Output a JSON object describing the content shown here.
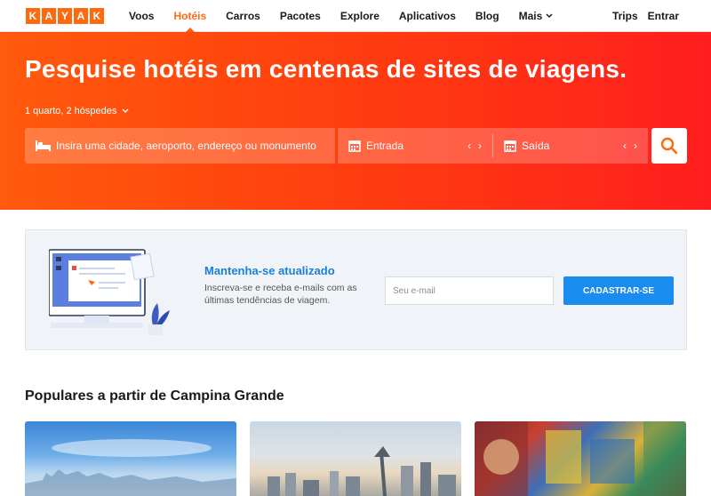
{
  "brand": {
    "logo_letters": [
      "K",
      "A",
      "Y",
      "A",
      "K"
    ],
    "accent": "#ff690f"
  },
  "nav": {
    "items": [
      {
        "label": "Voos",
        "active": false
      },
      {
        "label": "Hotéis",
        "active": true
      },
      {
        "label": "Carros",
        "active": false
      },
      {
        "label": "Pacotes",
        "active": false
      },
      {
        "label": "Explore",
        "active": false
      },
      {
        "label": "Aplicativos",
        "active": false
      },
      {
        "label": "Blog",
        "active": false
      },
      {
        "label": "Mais",
        "active": false
      }
    ],
    "trips": "Trips",
    "signin": "Entrar"
  },
  "hero": {
    "title": "Pesquise hotéis em centenas de sites de viagens.",
    "guests": "1 quarto, 2 hóspedes",
    "destination_placeholder": "Insira uma cidade, aeroporto, endereço ou monumento",
    "checkin_label": "Entrada",
    "checkout_label": "Saída",
    "gradient": [
      "#ff5a0d",
      "#ff1e1e"
    ]
  },
  "newsletter": {
    "title": "Mantenha-se atualizado",
    "description": "Inscreva-se e receba e-mails com as últimas tendências de viagem.",
    "email_placeholder": "Seu e-mail",
    "button": "CADASTRAR-SE",
    "title_color": "#1a7fd9",
    "button_color": "#1a8cf0"
  },
  "popular": {
    "title": "Populares a partir de Campina Grande"
  }
}
